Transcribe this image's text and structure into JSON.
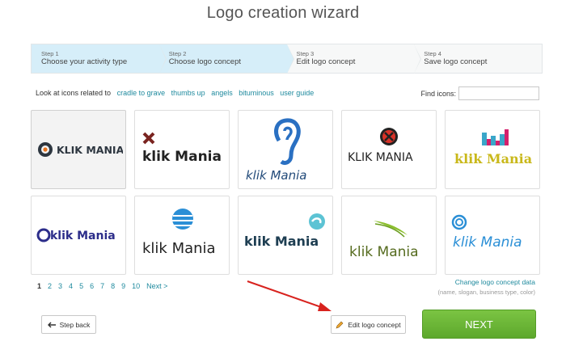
{
  "title": "Logo creation wizard",
  "steps": [
    {
      "num": "Step 1",
      "label": "Choose your activity type",
      "state": "done"
    },
    {
      "num": "Step 2",
      "label": "Choose logo concept",
      "state": "active"
    },
    {
      "num": "Step 3",
      "label": "Edit logo concept",
      "state": "todo"
    },
    {
      "num": "Step 4",
      "label": "Save logo concept",
      "state": "todo"
    }
  ],
  "related": {
    "label": "Look at icons related to",
    "links": [
      "cradle to grave",
      "thumbs up",
      "angels",
      "bituminous",
      "user guide"
    ]
  },
  "find": {
    "label": "Find icons:",
    "value": "",
    "placeholder": ""
  },
  "logos": [
    {
      "text": "KLIK MANIA"
    },
    {
      "text": "klik Mania"
    },
    {
      "text": "klik Mania"
    },
    {
      "text": "KLIK MANIA"
    },
    {
      "text": "klik Mania"
    },
    {
      "text": "klik Mania"
    },
    {
      "text": "klik Mania"
    },
    {
      "text": "klik Mania"
    },
    {
      "text": "klik Mania"
    },
    {
      "text": "klik Mania"
    }
  ],
  "pager": {
    "pages": [
      "1",
      "2",
      "3",
      "4",
      "5",
      "6",
      "7",
      "8",
      "9",
      "10"
    ],
    "current": "1",
    "next": "Next >"
  },
  "concept": {
    "link": "Change logo concept data",
    "sub": "(name, slogan, business type, color)"
  },
  "buttons": {
    "back": "Step back",
    "edit": "Edit logo concept",
    "next": "NEXT"
  },
  "colors": {
    "accent": "#1f8a9e",
    "step_active": "#d6eef9",
    "next_green": "#6ab535"
  }
}
